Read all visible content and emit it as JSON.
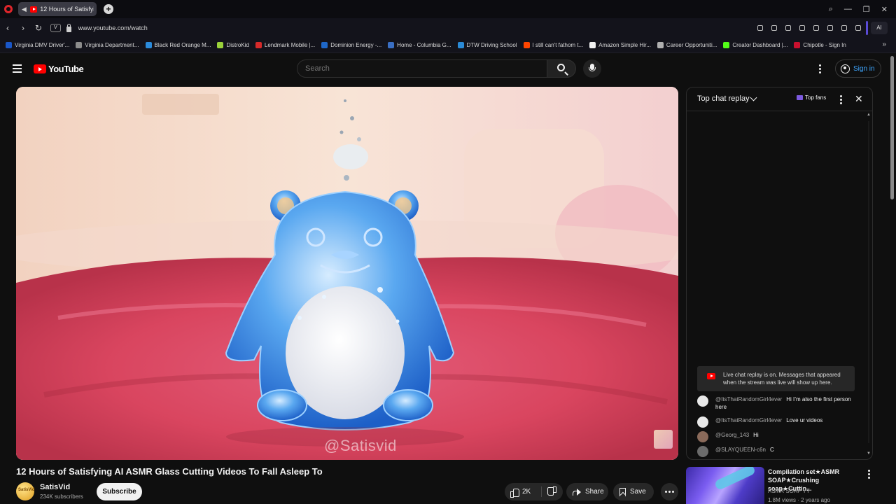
{
  "browser": {
    "tab_title": "12 Hours of Satisfying",
    "url": "www.youtube.com/watch",
    "vpn_label": "V",
    "ai_label": "AI",
    "bookmarks": [
      {
        "label": "Virginia DMV Driver'...",
        "color": "#1a57c9"
      },
      {
        "label": "Virginia Department...",
        "color": "#8c8c8c"
      },
      {
        "label": "Black Red Orange M...",
        "color": "#2b8bdc"
      },
      {
        "label": "DistroKid",
        "color": "#9ad23a"
      },
      {
        "label": "Lendmark Mobile |...",
        "color": "#d62a2a"
      },
      {
        "label": "Dominion Energy -...",
        "color": "#1e67c8"
      },
      {
        "label": "Home - Columbia G...",
        "color": "#3a6fc4"
      },
      {
        "label": "DTW Driving School",
        "color": "#2a8ad6"
      },
      {
        "label": "I still can't fathom t...",
        "color": "#ff4500"
      },
      {
        "label": "Amazon Simple Hir...",
        "color": "#f0f0f0"
      },
      {
        "label": "Career Opportuniti...",
        "color": "#b0b0b0"
      },
      {
        "label": "Creator Dashboard |...",
        "color": "#53fc18"
      },
      {
        "label": "Chipotle - Sign In",
        "color": "#c8102e"
      }
    ]
  },
  "masthead": {
    "logo_text": "YouTube",
    "search_placeholder": "Search",
    "signin_label": "Sign in"
  },
  "player": {
    "watermark": "@Satisvid"
  },
  "chat": {
    "title": "Top chat replay",
    "top_fans_label": "Top fans",
    "close_glyph": "✕",
    "replay_notice": "Live chat replay is on. Messages that appeared when the stream was live will show up here.",
    "messages": [
      {
        "author": "@ItsThatRandomGirl4ever",
        "text": "Hi I’m also the first person here",
        "avatar_color": "#e8e8e8"
      },
      {
        "author": "@ItsThatRandomGirl4ever",
        "text": "Love ur videos",
        "avatar_color": "#e8e8e8"
      },
      {
        "author": "@Georg_143",
        "text": "Hi",
        "avatar_color": "#8a6a5a"
      },
      {
        "author": "@SLAYQUEEN-c6n",
        "text": "C",
        "avatar_color": "#6b6b6b"
      }
    ]
  },
  "video": {
    "title": "12 Hours of Satisfying AI ASMR Glass Cutting Videos To Fall Asleep To",
    "channel_name": "SatisVid",
    "channel_avatar_text": "SatisVid",
    "subscribers": "234K subscribers",
    "subscribe_label": "Subscribe",
    "like_count": "2K",
    "share_label": "Share",
    "save_label": "Save"
  },
  "recommendation": {
    "title": "Compilation set★ASMR SOAP★Crushing soap★Cuttin...",
    "channel": "ASMR SOAP YT",
    "meta": "1.8M views · 2 years ago"
  }
}
